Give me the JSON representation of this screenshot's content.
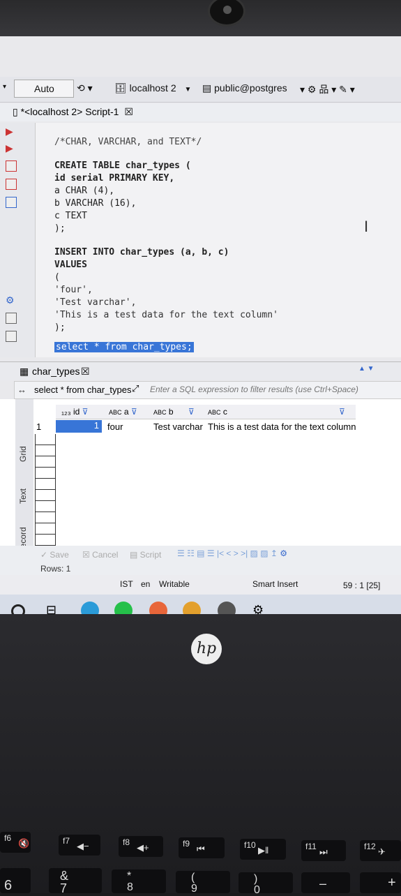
{
  "toolbar": {
    "mode": "Auto",
    "connection": "localhost 2",
    "schema": "public@postgres"
  },
  "tab": {
    "title": "*<localhost 2> Script-1"
  },
  "editor": {
    "lines": [
      "/*CHAR, VARCHAR, and TEXT*/",
      "CREATE TABLE char_types (",
      "id serial PRIMARY KEY,",
      "a CHAR (4),",
      "b VARCHAR (16),",
      "c TEXT",
      ");",
      "INSERT INTO char_types (a, b, c)",
      "VALUES",
      "(",
      "'four',",
      "'Test varchar',",
      "'This is a test data for the text column'",
      ");",
      "select * from char_types;"
    ]
  },
  "results": {
    "tab_title": "char_types",
    "query": "select * from char_types",
    "filter_placeholder": "Enter a SQL expression to filter results (use Ctrl+Space)",
    "side_tabs": [
      "Grid",
      "Text",
      "Record"
    ],
    "columns": [
      "id",
      "a",
      "b",
      "c"
    ],
    "rows": [
      {
        "num": "1",
        "id": "1",
        "a": "four",
        "b": "Test varchar",
        "c": "This is a test data for the text column"
      }
    ],
    "actions": {
      "save": "Save",
      "cancel": "Cancel",
      "script": "Script"
    },
    "rows_count": "Rows: 1"
  },
  "statusbar": {
    "timezone": "IST",
    "lang": "en",
    "mode": "Writable",
    "insert": "Smart Insert",
    "position": "59 : 1 [25]"
  },
  "laptop": {
    "logo": "hp",
    "fkeys": [
      {
        "fn": "f6",
        "glyph": "🔇"
      },
      {
        "fn": "f7",
        "glyph": "◀−"
      },
      {
        "fn": "f8",
        "glyph": "◀+"
      },
      {
        "fn": "f9",
        "glyph": "⏮"
      },
      {
        "fn": "f10",
        "glyph": "▶‖"
      },
      {
        "fn": "f11",
        "glyph": "⏭"
      },
      {
        "fn": "f12",
        "glyph": "✈"
      }
    ],
    "numkeys": [
      "6",
      "&\n7",
      "*\n8",
      "(\n9",
      ")\n0",
      "–",
      "+"
    ]
  },
  "colors": {
    "selection": "#3875d7",
    "taskbar": "#d7dde8",
    "editor_bg": "#f2f2f4"
  }
}
